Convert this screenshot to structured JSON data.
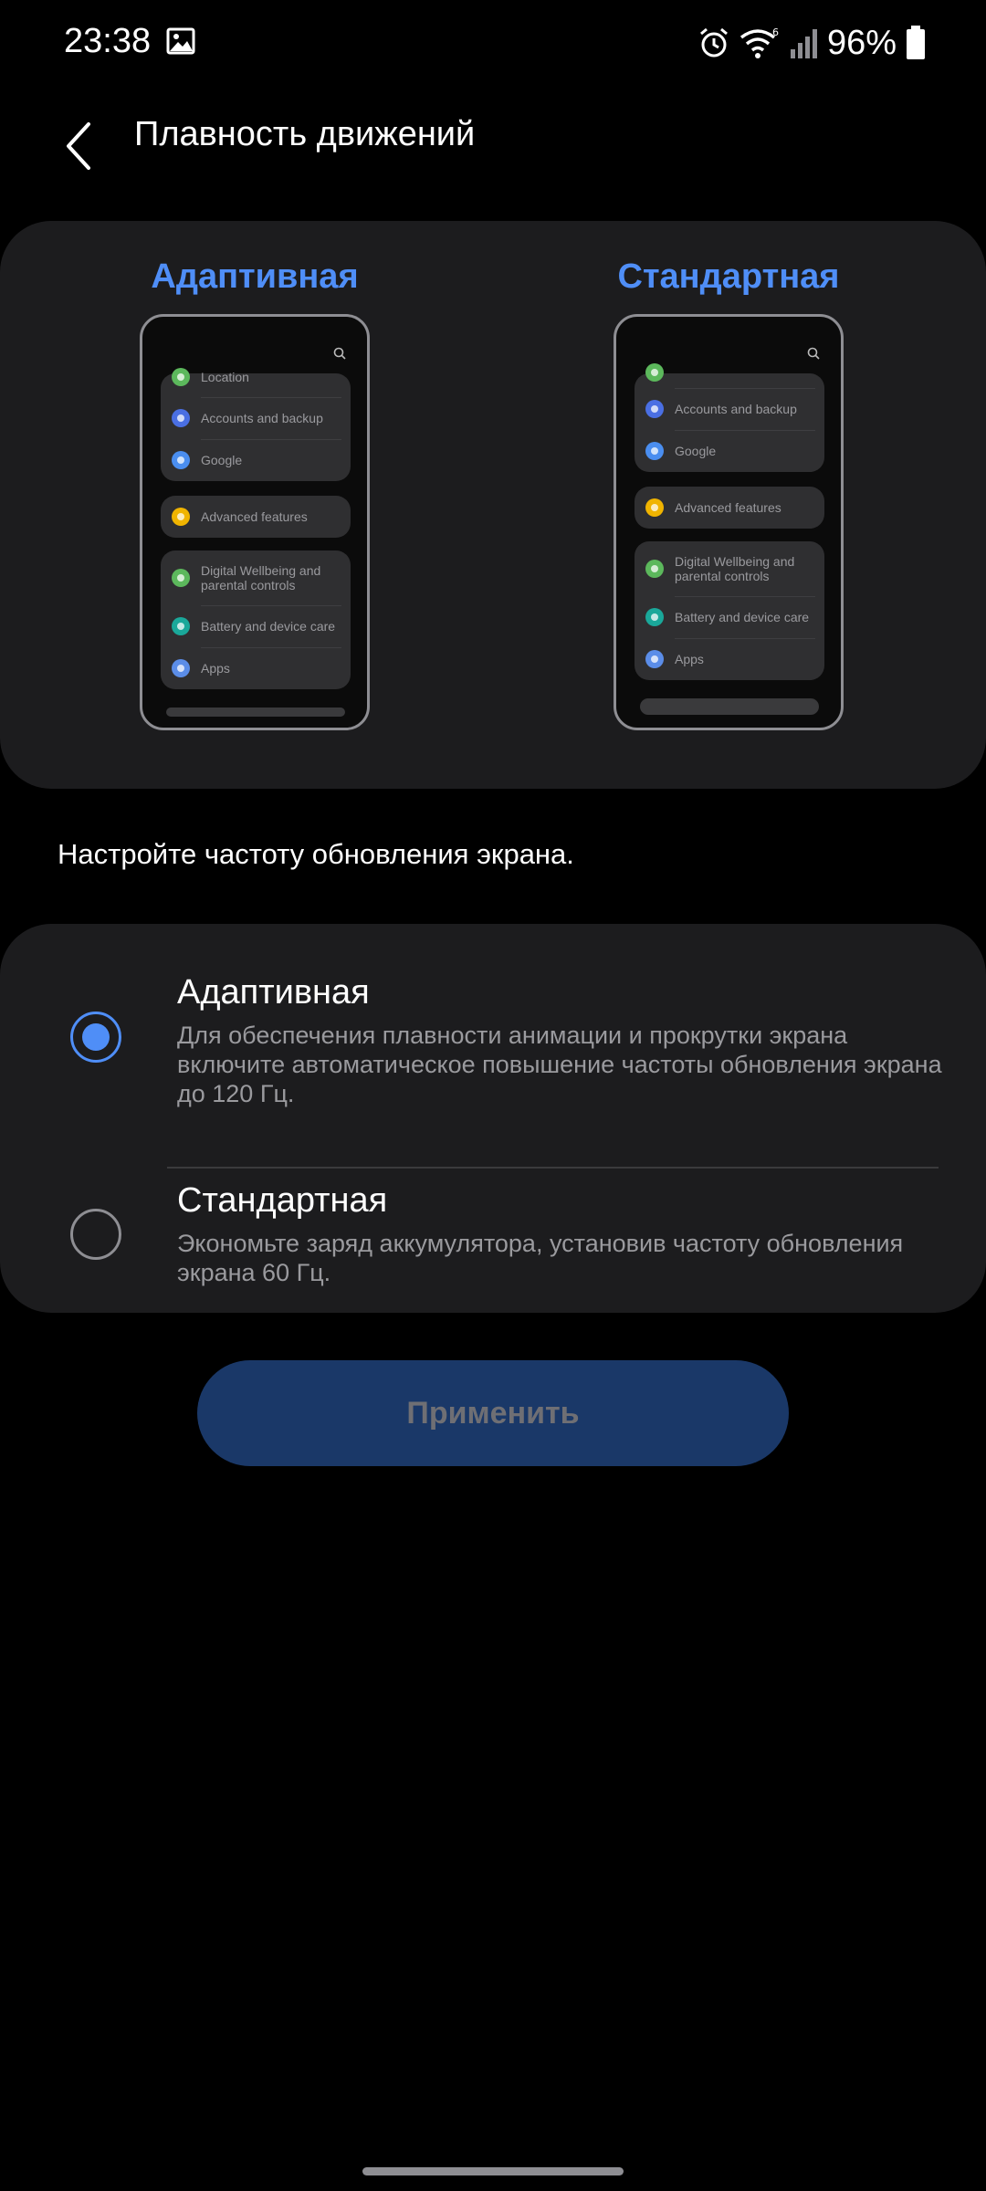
{
  "status_bar": {
    "time": "23:38",
    "battery": "96%",
    "icons": [
      "image-icon",
      "alarm-icon",
      "wifi-icon",
      "signal-icon",
      "battery-icon"
    ]
  },
  "header": {
    "title": "Плавность движений",
    "back_icon": "chevron-left-icon"
  },
  "preview": {
    "adaptive_label": "Адаптивная",
    "standard_label": "Стандартная",
    "adaptive_items": [
      {
        "label": "Location",
        "color": "#5cb85c"
      },
      {
        "label": "Accounts and backup",
        "color": "#4a6fe3"
      },
      {
        "label": "Google",
        "color": "#4a8ef0"
      },
      {
        "label": "Advanced features",
        "color": "#f0b400"
      },
      {
        "label": "Digital Wellbeing and parental controls",
        "color": "#5cb85c"
      },
      {
        "label": "Battery and device care",
        "color": "#1aa89a"
      },
      {
        "label": "Apps",
        "color": "#5b8de8"
      }
    ],
    "standard_items": [
      {
        "label": "Accounts and backup",
        "color": "#4a6fe3"
      },
      {
        "label": "Google",
        "color": "#4a8ef0"
      },
      {
        "label": "Advanced features",
        "color": "#f0b400"
      },
      {
        "label": "Digital Wellbeing and parental controls",
        "color": "#5cb85c"
      },
      {
        "label": "Battery and device care",
        "color": "#1aa89a"
      },
      {
        "label": "Apps",
        "color": "#5b8de8"
      }
    ]
  },
  "description": "Настройте частоту обновления экрана.",
  "options": [
    {
      "title": "Адаптивная",
      "desc": "Для обеспечения плавности анимации и прокрутки экрана включите автоматическое повышение частоты обновления экрана до 120 Гц.",
      "selected": true
    },
    {
      "title": "Стандартная",
      "desc": "Экономьте заряд аккумулятора, установив частоту обновления экрана 60 Гц.",
      "selected": false
    }
  ],
  "apply_label": "Применить",
  "colors": {
    "accent": "#4f8ef7",
    "card": "#1c1c1e",
    "button_disabled": "#1a3868"
  }
}
